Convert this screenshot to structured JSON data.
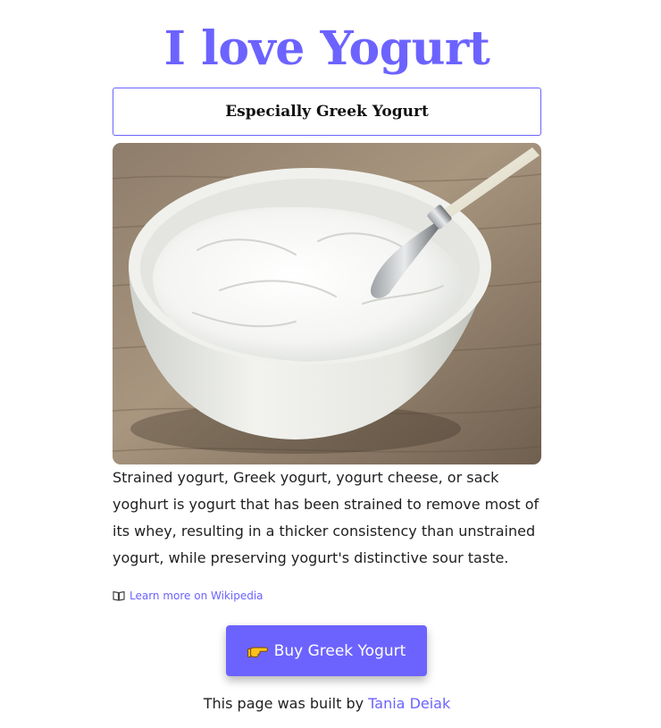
{
  "header": {
    "title": "I love Yogurt",
    "subtitle": "Especially Greek Yogurt"
  },
  "image": {
    "alt": "Bowl of strained Greek yogurt with a spoon",
    "icon": "yogurt-bowl-photo"
  },
  "content": {
    "description": "Strained yogurt, Greek yogurt, yogurt cheese, or sack yoghurt is yogurt that has been strained to remove most of its whey, resulting in a thicker consistency than unstrained yogurt, while preserving yogurt's distinctive sour taste.",
    "wiki_link_label": "Learn more on Wikipedia",
    "wiki_icon": "book-icon"
  },
  "cta": {
    "buy_label": "Buy Greek Yogurt",
    "icon": "pointing-hand-icon"
  },
  "footer": {
    "prefix": "This page was built by",
    "author": "Tania Deiak"
  },
  "colors": {
    "accent": "#6c63ff",
    "text": "#1f1f1f",
    "background": "#ffffff"
  }
}
